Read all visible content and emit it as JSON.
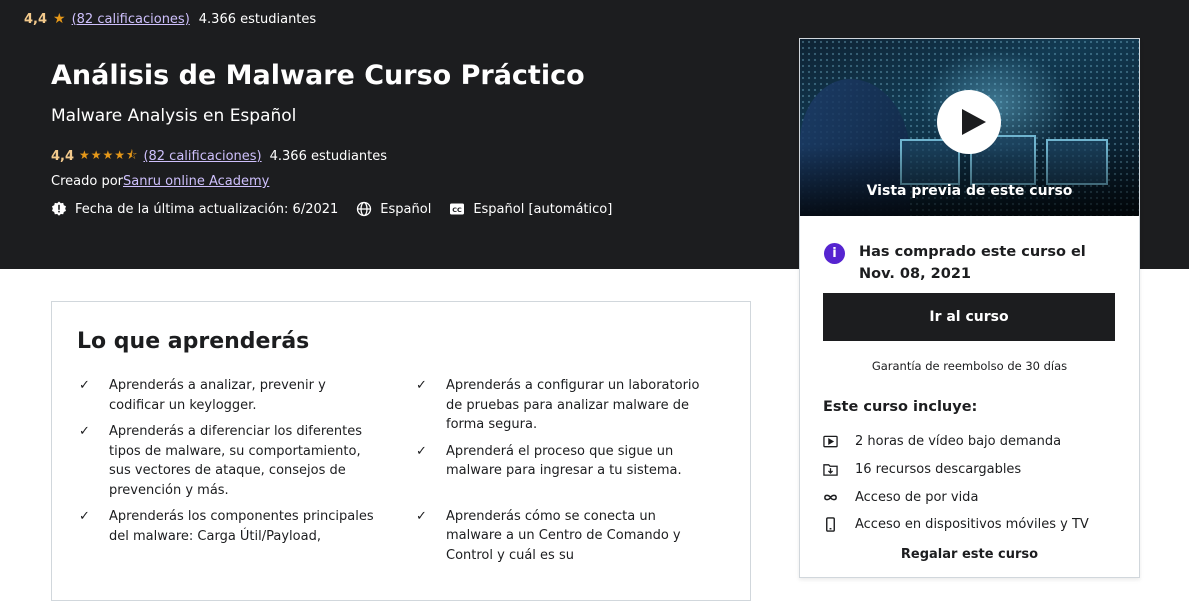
{
  "sticky": {
    "rating": "4,4",
    "ratings_link": "(82 calificaciones)",
    "students": "4.366 estudiantes"
  },
  "course": {
    "title": "Análisis de Malware Curso Práctico",
    "subtitle": "Malware Analysis en Español",
    "rating": "4,4",
    "stars": "★★★★⯪",
    "ratings_link": "(82 calificaciones)",
    "students": "4.366 estudiantes",
    "created_by_label": "Creado por",
    "creator": "Sanru online Academy",
    "last_update": "Fecha de la última actualización: 6/2021",
    "language": "Español",
    "captions": "Español [automático]"
  },
  "sidebar": {
    "preview_label": "Vista previa de este curso",
    "purchased_text": "Has comprado este curso el Nov. 08, 2021",
    "go_button": "Ir al curso",
    "guarantee": "Garantía de reembolso de 30 días",
    "includes_title": "Este curso incluye:",
    "includes": [
      {
        "icon": "video-icon",
        "text": "2 horas de vídeo bajo demanda"
      },
      {
        "icon": "download-icon",
        "text": "16 recursos descargables"
      },
      {
        "icon": "infinity-icon",
        "text": "Acceso de por vida"
      },
      {
        "icon": "mobile-icon",
        "text": "Acceso en dispositivos móviles y TV"
      }
    ],
    "gift": "Regalar este curso"
  },
  "learn": {
    "title": "Lo que aprenderás",
    "left": [
      "Aprenderás a analizar, prevenir y codificar un keylogger.",
      "Aprenderás a diferenciar los diferentes tipos de malware, su comportamiento, sus vectores de ataque, consejos de prevención y más.",
      "Aprenderás los componentes principales del malware: Carga Útil/Payload,"
    ],
    "right": [
      "Aprenderás a configurar un laboratorio de pruebas para analizar malware de forma segura.",
      "Aprenderá el proceso que sigue un malware para ingresar a tu sistema.",
      "Aprenderás cómo se conecta un malware a un Centro de Comando y Control y cuál es su"
    ]
  }
}
